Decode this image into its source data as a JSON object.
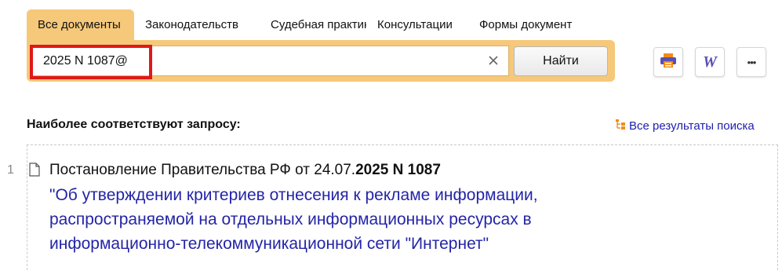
{
  "tabs": [
    {
      "label": "Все документы",
      "active": true
    },
    {
      "label": "Законодательств",
      "active": false
    },
    {
      "label": "Судебная практик",
      "active": false
    },
    {
      "label": "Консультации",
      "active": false
    },
    {
      "label": "Формы документ",
      "active": false
    }
  ],
  "search": {
    "value": "2025 N 1087@",
    "clear_icon": "close-icon",
    "find_label": "Найти"
  },
  "toolbar": {
    "print_icon": "printer-icon",
    "word_icon": "word-icon",
    "word_glyph": "W",
    "more_icon": "more-icon",
    "more_glyph": "•••"
  },
  "results": {
    "title": "Наиболее соответствуют запросу:",
    "all_results_label": "Все результаты поиска",
    "items": [
      {
        "number": "1",
        "prefix": "Постановление Правительства РФ от 24.07.",
        "bold": "2025 N 1087",
        "link": "\"Об утверждении критериев отнесения к рекламе информации, распространяемой на отдельных информационных ресурсах в информационно-телекоммуникационной сети \"Интернет\""
      }
    ]
  },
  "colors": {
    "accent": "#f6c87a",
    "link": "#2424a8",
    "highlight": "#e01818",
    "print_orange": "#f08c1a",
    "word_purple": "#5a4fb0"
  }
}
